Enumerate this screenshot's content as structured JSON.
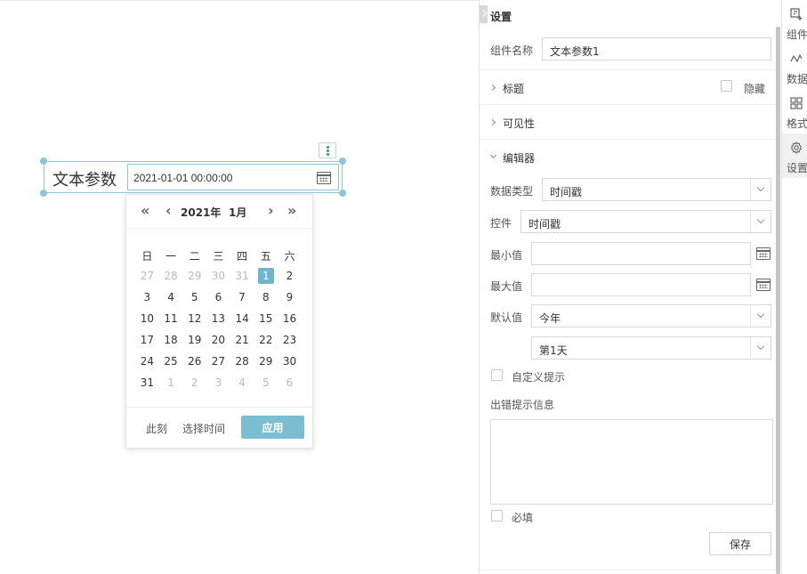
{
  "widget": {
    "label": "文本参数",
    "value": "2021-01-01 00:00:00"
  },
  "datepicker": {
    "prev_year": "«",
    "prev_month": "‹",
    "next_month": "›",
    "next_year": "»",
    "year": "2021年",
    "month": "1月",
    "weekdays": [
      "日",
      "一",
      "二",
      "三",
      "四",
      "五",
      "六"
    ],
    "weeks": [
      [
        "27",
        "28",
        "29",
        "30",
        "31",
        "1",
        "2"
      ],
      [
        "3",
        "4",
        "5",
        "6",
        "7",
        "8",
        "9"
      ],
      [
        "10",
        "11",
        "12",
        "13",
        "14",
        "15",
        "16"
      ],
      [
        "17",
        "18",
        "19",
        "20",
        "21",
        "22",
        "23"
      ],
      [
        "24",
        "25",
        "26",
        "27",
        "28",
        "29",
        "30"
      ],
      [
        "31",
        "1",
        "2",
        "3",
        "4",
        "5",
        "6"
      ]
    ],
    "selected_day": "1",
    "now_label": "此刻",
    "select_time_label": "选择时间",
    "apply_label": "应用",
    "accent_color": "#7bbdd1"
  },
  "panel": {
    "title": "设置",
    "component_name_label": "组件名称",
    "component_name_value": "文本参数1",
    "title_section": "标题",
    "hide_label": "隐藏",
    "visibility_section": "可见性",
    "editor_section": "编辑器",
    "data_type_label": "数据类型",
    "data_type_value": "时间戳",
    "control_label": "控件",
    "control_value": "时间戳",
    "min_label": "最小值",
    "min_value": "",
    "max_label": "最大值",
    "max_value": "",
    "default_label": "默认值",
    "default_value": "今年",
    "default_sub_value": "第1天",
    "custom_hint_label": "自定义提示",
    "error_msg_label": "出错提示信息",
    "error_msg_value": "",
    "required_label": "必填",
    "save_label": "保存"
  },
  "tabs": [
    {
      "label": "组件",
      "icon": "component-icon"
    },
    {
      "label": "数据",
      "icon": "data-icon"
    },
    {
      "label": "格式",
      "icon": "format-icon"
    },
    {
      "label": "设置",
      "icon": "settings-icon",
      "active": true
    }
  ]
}
